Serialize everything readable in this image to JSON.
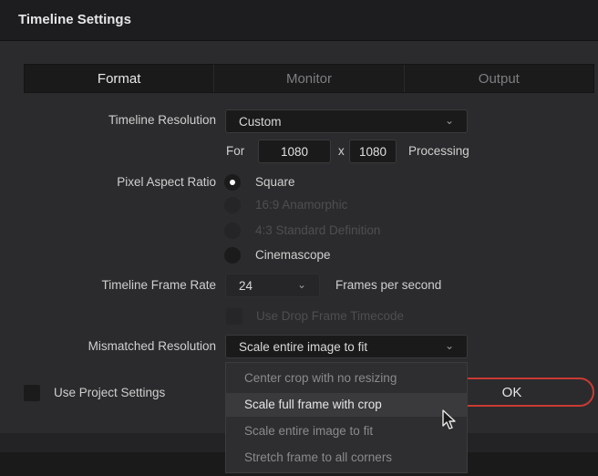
{
  "window": {
    "title": "Timeline Settings"
  },
  "tabs": [
    {
      "label": "Format",
      "active": true
    },
    {
      "label": "Monitor",
      "active": false
    },
    {
      "label": "Output",
      "active": false
    }
  ],
  "resolution": {
    "label": "Timeline Resolution",
    "selected": "Custom",
    "for_label": "For",
    "width": "1080",
    "x_label": "x",
    "height": "1080",
    "processing_label": "Processing"
  },
  "pixel_aspect": {
    "label": "Pixel Aspect Ratio",
    "options": [
      {
        "label": "Square",
        "selected": true,
        "enabled": true
      },
      {
        "label": "16:9 Anamorphic",
        "selected": false,
        "enabled": false
      },
      {
        "label": "4:3 Standard Definition",
        "selected": false,
        "enabled": false
      },
      {
        "label": "Cinemascope",
        "selected": false,
        "enabled": true
      }
    ]
  },
  "frame_rate": {
    "label": "Timeline Frame Rate",
    "value": "24",
    "unit_label": "Frames per second",
    "drop_frame_label": "Use Drop Frame Timecode"
  },
  "mismatched": {
    "label": "Mismatched Resolution",
    "selected": "Scale entire image to fit",
    "options": [
      {
        "label": "Center crop with no resizing",
        "highlighted": false
      },
      {
        "label": "Scale full frame with crop",
        "highlighted": true
      },
      {
        "label": "Scale entire image to fit",
        "highlighted": false
      },
      {
        "label": "Stretch frame to all corners",
        "highlighted": false
      }
    ]
  },
  "project_settings": {
    "label": "Use Project Settings",
    "checked": false
  },
  "ok_button": {
    "label": "OK"
  },
  "colors": {
    "accent": "#c93a34",
    "background": "#2b2b2d",
    "panel": "#1b1b1c"
  }
}
